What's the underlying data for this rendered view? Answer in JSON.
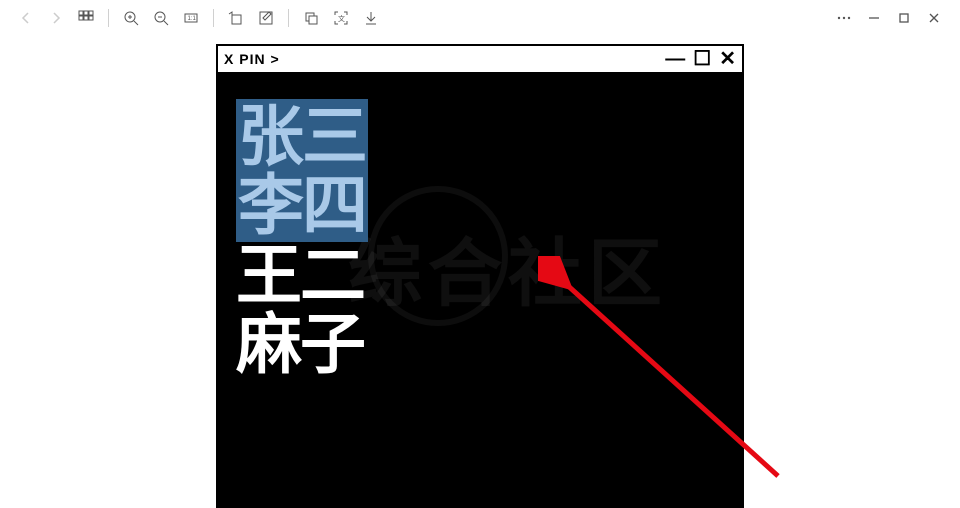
{
  "editor": {
    "title": "X PIN  >",
    "lines": [
      "张三",
      "李四",
      "王二",
      "麻子"
    ],
    "selected_lines": [
      0,
      1
    ],
    "partial_selection_line": 2,
    "partial_selection_chars": 0
  },
  "watermark": "综合社区",
  "annotation": {
    "arrow_color": "#e50914"
  }
}
